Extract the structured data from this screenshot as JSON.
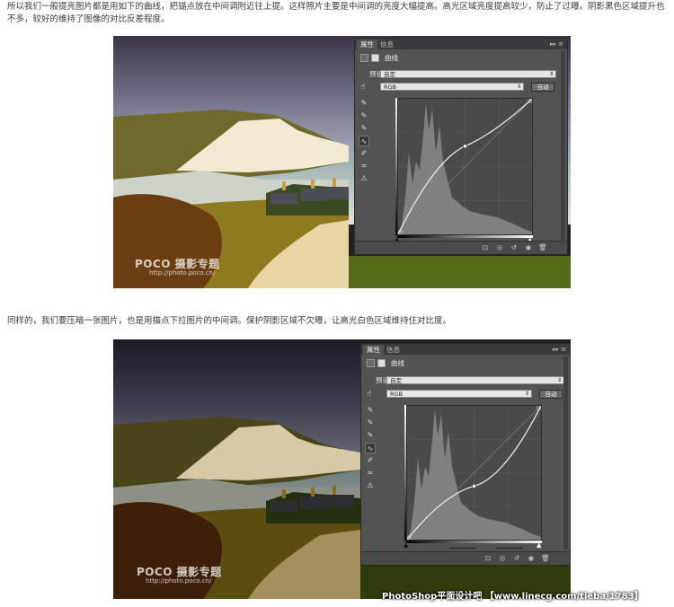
{
  "paragraph1": "所以我们一般提亮图片都是用如下的曲线，把锚点放在中间调附近往上提。这样照片主要是中间调的亮度大幅提高。高光区域亮度提高较少，防止了过曝。阴影黑色区域提升也不多，较好的维持了图像的对比反差程度。",
  "paragraph2": "同样的，我们要压暗一张图片，也是用描点下拉图片的中间调。保护阴影区域不欠曝，让高光白色区域维持住对比度。",
  "watermark": {
    "brand": "POCO 摄影专题",
    "url": "http://photo.poco.cn/"
  },
  "panel": {
    "tab_properties": "属性",
    "tab_info": "信息",
    "tab_controls": "▸▸ ≡",
    "title": "曲线",
    "preset_label": "预设:",
    "preset_value": "自定",
    "channel_value": "RGB",
    "auto_button": "自动"
  },
  "curves": {
    "brighten": {
      "control_point": [
        0.5,
        0.65
      ]
    },
    "darken": {
      "control_point": [
        0.5,
        0.4
      ]
    }
  },
  "footer": "PhotoShop平面设计吧 【www.linecg.com/tieba/1783】"
}
